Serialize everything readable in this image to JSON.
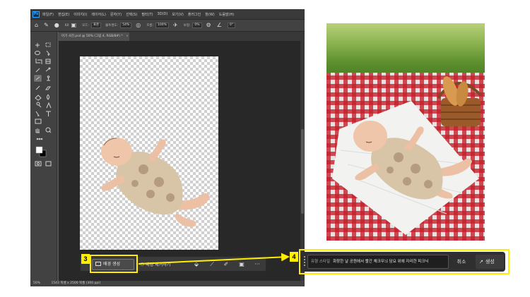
{
  "photoshop": {
    "logo": "Ps",
    "menu": [
      "파일(F)",
      "편집(E)",
      "이미지(I)",
      "레이어(L)",
      "문자(Y)",
      "선택(S)",
      "필터(T)",
      "3D(D)",
      "보기(V)",
      "플러그인",
      "창(W)",
      "도움말(H)"
    ],
    "options": {
      "size": "60",
      "mode_label": "모드:",
      "mode_value": "표준",
      "opacity_label": "불투명도:",
      "opacity_value": "54%",
      "flow_label": "흐름:",
      "flow_value": "100%",
      "smoothing_label": "보정:",
      "smoothing_value": "0%",
      "angle_value": "0°"
    },
    "document_tab": "아기 사진.psd @ 50% (그림 4, RGB/8#) *",
    "document_tab_close": "×",
    "status": {
      "zoom": "50%",
      "info": "1543 픽셀 x 2500 픽셀 (300 ppi)"
    },
    "taskbar": {
      "generate_background": "배경 생성",
      "remove_background": "배경 제거하기",
      "more": "···"
    }
  },
  "prompt_bar": {
    "hint": "유형 스타일",
    "prompt_text": "화창한 날 공원에서 빨간 체크무늬 담요 위에 자리한 피크닉",
    "cancel": "취소",
    "generate": "생성"
  },
  "callouts": {
    "step3": "3",
    "step4": "4"
  },
  "colors": {
    "highlight": "#ffee00",
    "ps_bg": "#535353",
    "canvas_bg": "#282828",
    "blanket_red": "#c41e2a"
  }
}
